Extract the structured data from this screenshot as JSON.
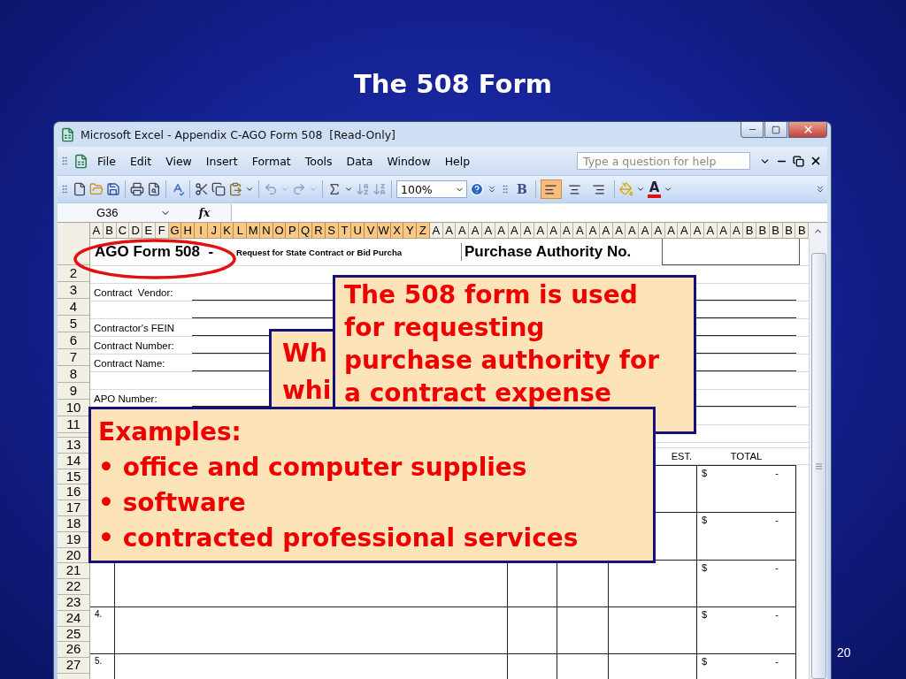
{
  "slide": {
    "title": "The 508 Form",
    "page_number": "20"
  },
  "window": {
    "title": "Microsoft Excel - Appendix C-AGO Form 508  [Read-Only]"
  },
  "menu": [
    {
      "label": "File"
    },
    {
      "label": "Edit"
    },
    {
      "label": "View"
    },
    {
      "label": "Insert"
    },
    {
      "label": "Format"
    },
    {
      "label": "Tools"
    },
    {
      "label": "Data"
    },
    {
      "label": "Window"
    },
    {
      "label": "Help"
    }
  ],
  "help_field": {
    "placeholder": "Type a question for help"
  },
  "toolbar": {
    "zoom": "100%",
    "bold": "B",
    "font_color": "A",
    "alignments": [
      {
        "selected": true
      },
      {
        "selected": false
      },
      {
        "selected": false
      }
    ]
  },
  "formula_bar": {
    "name_box": "G36",
    "function_label": "fx"
  },
  "columns": [
    {
      "label": "A",
      "selected": false
    },
    {
      "label": "B",
      "selected": false
    },
    {
      "label": "C",
      "selected": false
    },
    {
      "label": "D",
      "selected": false
    },
    {
      "label": "E",
      "selected": false
    },
    {
      "label": "F",
      "selected": false
    },
    {
      "label": "G",
      "selected": true
    },
    {
      "label": "H",
      "selected": true
    },
    {
      "label": "I",
      "selected": true
    },
    {
      "label": "J",
      "selected": true
    },
    {
      "label": "K",
      "selected": true
    },
    {
      "label": "L",
      "selected": true
    },
    {
      "label": "M",
      "selected": true
    },
    {
      "label": "N",
      "selected": true
    },
    {
      "label": "O",
      "selected": true
    },
    {
      "label": "P",
      "selected": true
    },
    {
      "label": "Q",
      "selected": true
    },
    {
      "label": "R",
      "selected": true
    },
    {
      "label": "S",
      "selected": true
    },
    {
      "label": "T",
      "selected": true
    },
    {
      "label": "U",
      "selected": true
    },
    {
      "label": "V",
      "selected": true
    },
    {
      "label": "W",
      "selected": true
    },
    {
      "label": "X",
      "selected": true
    },
    {
      "label": "Y",
      "selected": true
    },
    {
      "label": "Z",
      "selected": true
    },
    {
      "label": "A",
      "selected": false
    },
    {
      "label": "A",
      "selected": false
    },
    {
      "label": "A",
      "selected": false
    },
    {
      "label": "A",
      "selected": false
    },
    {
      "label": "A",
      "selected": false
    },
    {
      "label": "A",
      "selected": false
    },
    {
      "label": "A",
      "selected": false
    },
    {
      "label": "A",
      "selected": false
    },
    {
      "label": "A",
      "selected": false
    },
    {
      "label": "A",
      "selected": false
    },
    {
      "label": "A",
      "selected": false
    },
    {
      "label": "A",
      "selected": false
    },
    {
      "label": "A",
      "selected": false
    },
    {
      "label": "A",
      "selected": false
    },
    {
      "label": "A",
      "selected": false
    },
    {
      "label": "A",
      "selected": false
    },
    {
      "label": "A",
      "selected": false
    },
    {
      "label": "A",
      "selected": false
    },
    {
      "label": "A",
      "selected": false
    },
    {
      "label": "A",
      "selected": false
    },
    {
      "label": "A",
      "selected": false
    },
    {
      "label": "A",
      "selected": false
    },
    {
      "label": "A",
      "selected": false
    },
    {
      "label": "A",
      "selected": false
    },
    {
      "label": "B",
      "selected": false
    },
    {
      "label": "B",
      "selected": false
    },
    {
      "label": "B",
      "selected": false
    },
    {
      "label": "B",
      "selected": false
    },
    {
      "label": "B",
      "selected": false
    }
  ],
  "row_numbers": {
    "form": [
      "2",
      "3",
      "4",
      "5",
      "6",
      "7",
      "8",
      "9",
      "10",
      "11"
    ],
    "table": [
      "13",
      "14",
      "15",
      "16",
      "17",
      "18",
      "19",
      "20",
      "21",
      "22",
      "23",
      "24",
      "25",
      "26",
      "27"
    ]
  },
  "sheet": {
    "title": "AGO Form 508  -",
    "subtitle": "Request for State Contract or Bid Purcha",
    "authority_label": "Purchase Authority No.",
    "form_rows": [
      {
        "kind": "blank"
      },
      {
        "kind": "field",
        "label": "Contract  Vendor:"
      },
      {
        "kind": "field"
      },
      {
        "kind": "field",
        "label": "Contractor's FEIN"
      },
      {
        "kind": "field",
        "label": "Contract Number:"
      },
      {
        "kind": "field",
        "label": "Contract Name:"
      },
      {
        "kind": "blank"
      },
      {
        "kind": "field",
        "label": "APO Number:"
      },
      {
        "kind": "blank"
      },
      {
        "kind": "blank"
      }
    ],
    "table_headers": {
      "estimate": "EST.",
      "total": "TOTAL"
    },
    "items": [
      {
        "currency": "$",
        "total": "-"
      },
      {
        "currency": "$",
        "total": "-"
      },
      {
        "currency": "$",
        "total": "-"
      },
      {
        "number": "4.",
        "currency": "$",
        "total": "-"
      },
      {
        "number": "5.",
        "currency": "$",
        "total": "-"
      }
    ]
  },
  "callouts": [
    {
      "kind": "paragraph",
      "lines": [
        "Wh",
        "whi"
      ]
    },
    {
      "kind": "paragraph",
      "lines": [
        "The 508 form is used",
        "for requesting",
        "purchase authority for",
        "a contract expense"
      ]
    },
    {
      "kind": "list",
      "heading": "Examples:",
      "items": [
        "• office and computer supplies",
        "• software",
        "• contracted professional services"
      ]
    }
  ]
}
